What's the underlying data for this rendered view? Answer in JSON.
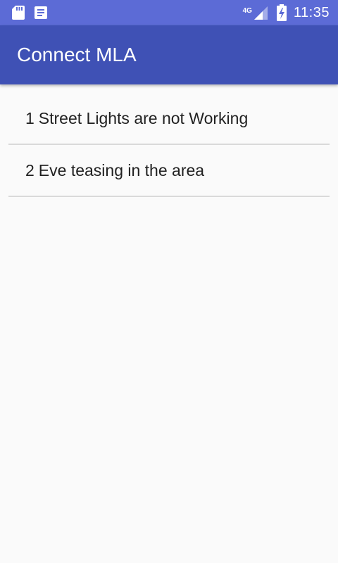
{
  "status_bar": {
    "network_type": "4G",
    "time": "11:35",
    "icons": [
      "sd-card-icon",
      "notes-icon",
      "signal-icon",
      "battery-charging-icon"
    ]
  },
  "app_bar": {
    "title": "Connect MLA"
  },
  "issues": [
    {
      "number": "1",
      "text": "Street Lights are not Working"
    },
    {
      "number": "2",
      "text": "Eve teasing in the area"
    }
  ],
  "colors": {
    "status_bar": "#5c6bd6",
    "primary": "#3f51b5",
    "background": "#fafafa",
    "divider": "#d9d9d9",
    "text": "#212121"
  }
}
